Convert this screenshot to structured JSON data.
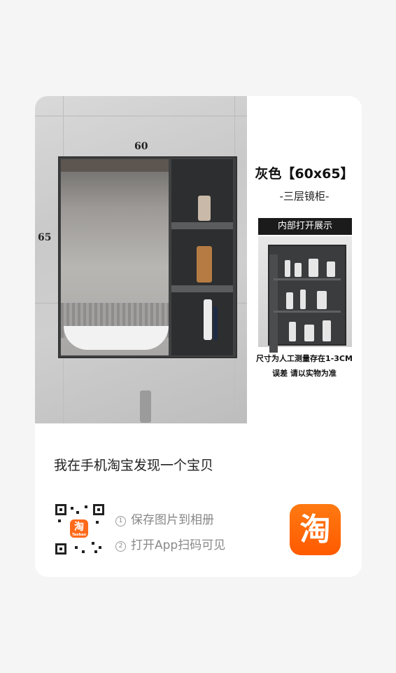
{
  "product_image": {
    "dimension_width": "60",
    "dimension_height": "65",
    "color_title": "灰色【60x65】",
    "subtitle": "-三层镜柜-",
    "inner_label": "内部打开展示",
    "note_line1": "尺寸为人工测量存在1-3CM",
    "note_line2": "误差 请以实物为准"
  },
  "share": {
    "headline": "我在手机淘宝发现一个宝贝",
    "step1_num": "1",
    "step1_text": "保存图片到相册",
    "step2_num": "2",
    "step2_text": "打开App扫码可见",
    "qr_logo_char": "淘",
    "qr_logo_sub": "Taobao",
    "app_logo_char": "淘"
  },
  "colors": {
    "brand_orange": "#ff5a00",
    "card_bg": "#ffffff",
    "page_bg": "#f5f5f5"
  },
  "icons": [
    "qr-code-icon",
    "taobao-logo-icon"
  ]
}
